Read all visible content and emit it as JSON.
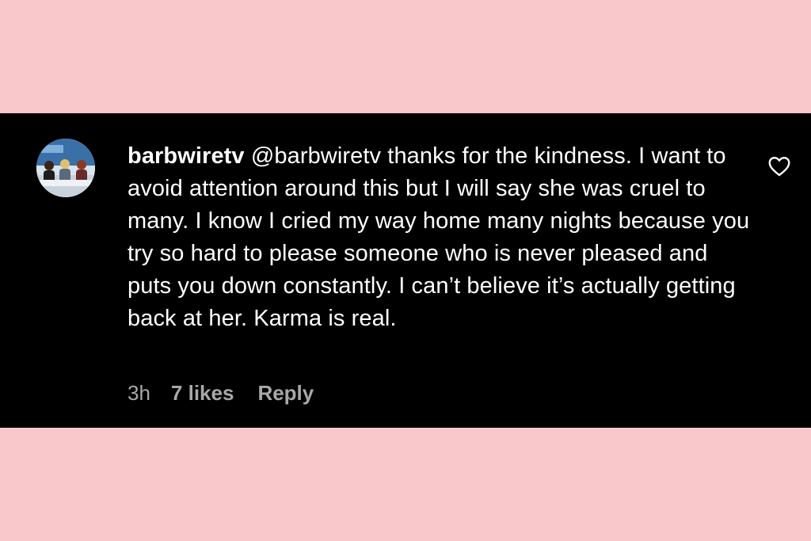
{
  "colors": {
    "background": "#f8c8cb",
    "panel": "#000000",
    "text": "#ffffff",
    "meta_text": "#a8a8a8"
  },
  "comment": {
    "username": "barbwiretv",
    "text": " @barbwiretv thanks for the kindness. I want to avoid attention around this but I will say she was cruel to many. I know I cried my way home many nights because you try so hard to please someone who is never pleased and puts you down constantly. I can’t believe it’s actually getting back at her. Karma is real.",
    "time": "3h",
    "likes": "7 likes",
    "reply_label": "Reply",
    "like_icon": "heart-outline-icon"
  }
}
